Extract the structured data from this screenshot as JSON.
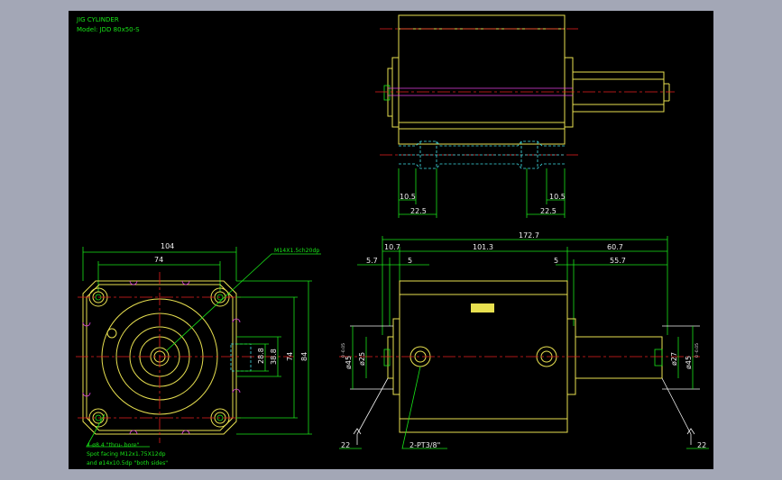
{
  "header": {
    "title": "JIG CYLINDER",
    "model": "Model: JDD 80x50-S"
  },
  "top_view": {
    "dims": {
      "left_inner": "10.5",
      "left_outer": "22.5",
      "right_inner": "10.5",
      "right_outer": "22.5"
    }
  },
  "front_view": {
    "dims": {
      "width": "104",
      "bolt_span": "74",
      "h1": "28.8",
      "h2": "38.8",
      "h3": "74",
      "h4": "84"
    },
    "thread_note": "M14X1.5ch20dp",
    "note_line1": "4-ø8.4 \"thru- bore\"",
    "note_line2": "Spot facing  M12x1.75X12dp",
    "note_line3": "and ø14x10.5dp \"both sides\""
  },
  "side_view": {
    "dims": {
      "overall": "172.7",
      "seg_a": "10.7",
      "seg_b": "101.3",
      "seg_c": "60.7",
      "left_small": "5.7",
      "left_5": "5",
      "right_5": "5",
      "right_len": "55.7",
      "dia_left_a": "ø45",
      "dia_left_tol": "0 -0.05",
      "dia_left_b": "ø25",
      "dia_right_a": "ø27",
      "dia_right_b": "ø45",
      "dia_right_tol": "0 -0.05",
      "foot_left": "22",
      "foot_right": "22",
      "port": "2-PT3/8\""
    }
  }
}
